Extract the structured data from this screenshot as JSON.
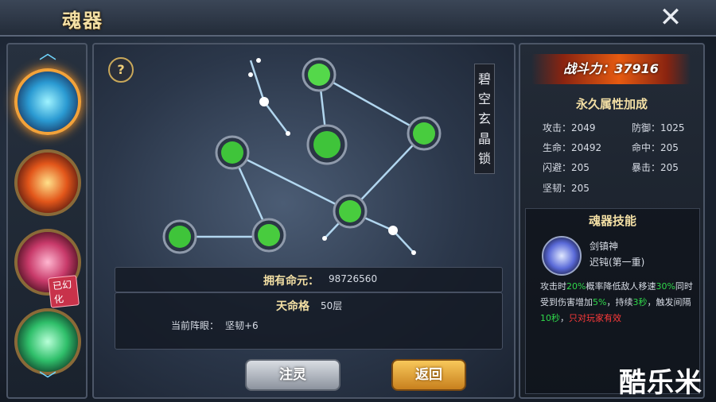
{
  "header": {
    "title": "魂器",
    "close_icon": "close-icon"
  },
  "left_panel": {
    "up_icon": "chevron-up-icon",
    "down_icon": "chevron-down-icon",
    "items": [
      {
        "name": "blue-soul-artifact",
        "selected": true,
        "tag": ""
      },
      {
        "name": "fire-soul-artifact",
        "selected": false,
        "tag": ""
      },
      {
        "name": "pink-soul-artifact",
        "selected": false,
        "tag": "已幻化"
      },
      {
        "name": "green-soul-artifact",
        "selected": false,
        "tag": ""
      }
    ]
  },
  "main": {
    "help": "?",
    "lock_name": "碧空玄晶锁",
    "owned_label": "拥有命元：",
    "owned_value": "98726560",
    "tianmingge_label": "天命格",
    "tianmingge_level": "50层",
    "current_label": "当前阵眼：",
    "current_value": "坚韧+6"
  },
  "right": {
    "power_label": "战斗力：",
    "power_value": "37916",
    "attr_header": "永久属性加成",
    "stats": [
      {
        "label": "攻击：",
        "value": "2049"
      },
      {
        "label": "防御：",
        "value": "1025"
      },
      {
        "label": "生命：",
        "value": "20492"
      },
      {
        "label": "命中：",
        "value": "205"
      },
      {
        "label": "闪避：",
        "value": "205"
      },
      {
        "label": "暴击：",
        "value": "205"
      },
      {
        "label": "坚韧：",
        "value": "205"
      }
    ],
    "skill_header": "魂器技能",
    "skill_name": "剑镇神",
    "skill_sub": "迟钝(第一重)",
    "skill_desc": {
      "p1": "攻击时",
      "p2": "20%",
      "p3": "概率降低敌人移速",
      "p4": "30%",
      "p5": "同时受到伤害增加",
      "p6": "5%",
      "p7": "，持续",
      "p8": "3秒",
      "p9": "，触发间隔",
      "p10": "10秒",
      "p11": "，",
      "p12": "只对玩家有效"
    }
  },
  "buttons": {
    "infuse": "注灵",
    "back": "返回"
  },
  "watermark": "酷乐米",
  "colors": {
    "highlight_green": "#2fd84a",
    "warning_red": "#ff3a3a",
    "gold": "#f3dfa4"
  }
}
